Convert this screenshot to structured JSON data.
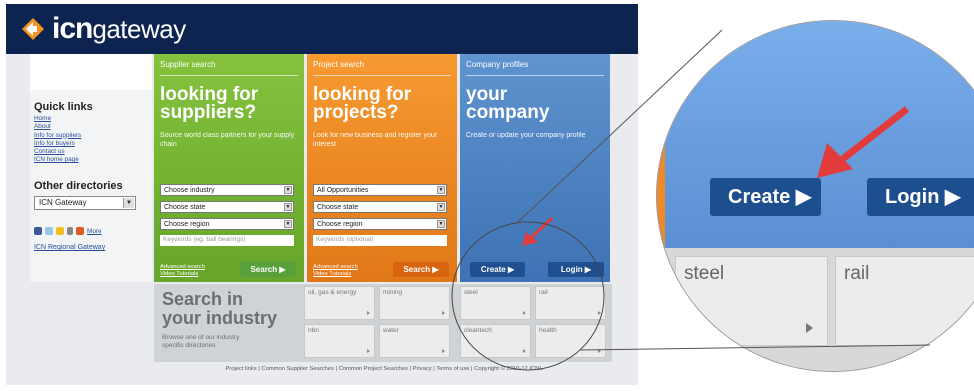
{
  "site": {
    "logo": {
      "bold": "icn",
      "light": "gateway"
    },
    "sidebar": {
      "quick_links_title": "Quick links",
      "links": [
        "Home",
        "About",
        "Info for suppliers",
        "Info for buyers",
        "Contact us",
        "ICN home page"
      ],
      "other_dirs_title": "Other directories",
      "directory_select": "ICN Gateway",
      "more_label": "More",
      "regional": "ICN Regional Gateway"
    },
    "supplier": {
      "caption": "Supplier search",
      "heading_1": "looking for",
      "heading_2": "suppliers?",
      "sub": "Source world class partners for your supply chain",
      "dd_industry": "Choose industry",
      "dd_state": "Choose state",
      "dd_region": "Choose region",
      "keywords_placeholder": "Keywords (eg. ball bearings)",
      "adv_1": "Advanced search",
      "adv_2": "Video Tutorials",
      "search_label": "Search"
    },
    "project": {
      "caption": "Project search",
      "heading_1": "looking for",
      "heading_2": "projects?",
      "sub": "Look for new business and register your interest",
      "dd_opps": "All Opportunities",
      "dd_state": "Choose state",
      "dd_region": "Choose region",
      "keywords_placeholder": "Keywords (optional)",
      "adv_1": "Advanced search",
      "adv_2": "Video Tutorials",
      "search_label": "Search"
    },
    "company": {
      "caption": "Company profiles",
      "heading_1": "your",
      "heading_2": "company",
      "sub": "Create or update your company profile",
      "create_label": "Create",
      "login_label": "Login"
    },
    "industry": {
      "title_1": "Search in",
      "title_2": "your industry",
      "sub_1": "Browse one of our industry",
      "sub_2": "specific directories",
      "tiles": [
        "oil, gas & energy",
        "mining",
        "steel",
        "rail",
        "nbn",
        "water",
        "cleantech",
        "health"
      ]
    },
    "footer": "Project links | Common Supplier Searches | Common Project Searches | Privacy | Terms of use | Copyright © 2010-12 ICNL"
  },
  "zoom": {
    "create_label": "Create",
    "login_label": "Login",
    "tile_1": "steel",
    "tile_2": "rail"
  },
  "colors": {
    "navy": "#0d2451",
    "green": "#7ab935",
    "orange": "#ef8a24",
    "blue": "#4f86c6",
    "button_blue": "#1f4f8f",
    "arrow_red": "#e23b3b"
  },
  "icons": {
    "arrow": "red-arrow-icon",
    "play": "play-triangle-icon",
    "logo": "diamond-arrows-icon"
  }
}
